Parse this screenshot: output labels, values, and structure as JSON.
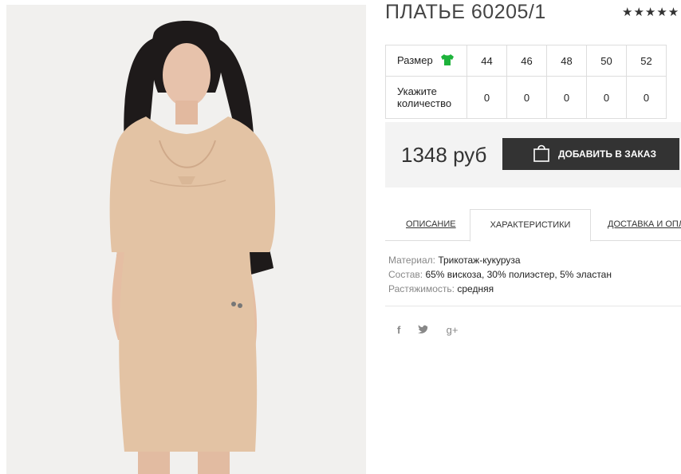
{
  "product": {
    "title": "ПЛАТЬЕ 60205/1",
    "rating_stars": "★★★★★"
  },
  "sizes": {
    "size_label": "Размер",
    "qty_label_line1": "Укажите",
    "qty_label_line2": "количество",
    "values": [
      "44",
      "46",
      "48",
      "50",
      "52"
    ],
    "quantities": [
      "0",
      "0",
      "0",
      "0",
      "0"
    ]
  },
  "order": {
    "price": "1348 руб",
    "add_label": "ДОБАВИТЬ В ЗАКАЗ"
  },
  "tabs": {
    "description": "ОПИСАНИЕ",
    "characteristics": "ХАРАКТЕРИСТИКИ",
    "delivery": "ДОСТАВКА И ОПЛ"
  },
  "specs": {
    "material_key": "Материал:",
    "material_val": "Трикотаж-кукуруза",
    "composition_key": "Состав:",
    "composition_val": "65% вискоза, 30% полиэстер, 5% эластан",
    "stretch_key": "Растяжимость:",
    "stretch_val": "средняя"
  },
  "social": {
    "facebook": "f",
    "twitter": "🐦",
    "googleplus": "g+"
  },
  "colors": {
    "accent_green": "#1db33b",
    "button_dark": "#333333",
    "dress": "#e3c3a4"
  }
}
